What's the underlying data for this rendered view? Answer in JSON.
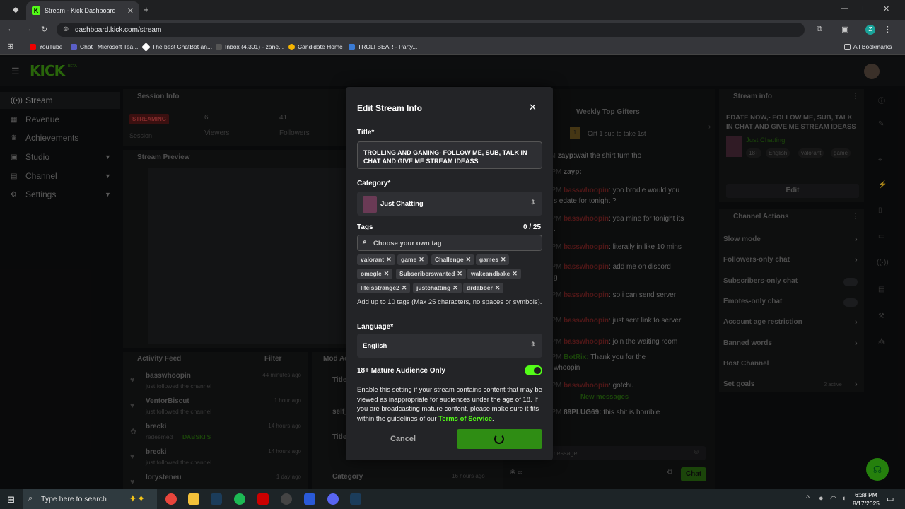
{
  "browser": {
    "tab_title": "Stream - Kick Dashboard",
    "url": "dashboard.kick.com/stream",
    "bookmarks": [
      "YouTube",
      "Chat | Microsoft Tea...",
      "The best ChatBot an...",
      "Inbox (4,301) - zane...",
      "Candidate Home",
      "TROLI BEAR - Party..."
    ],
    "all_bookmarks": "All Bookmarks"
  },
  "app": {
    "logo": "KICK",
    "logo_badge": "BETA",
    "sidebar": [
      {
        "label": "Stream",
        "active": true
      },
      {
        "label": "Revenue"
      },
      {
        "label": "Achievements"
      },
      {
        "label": "Studio",
        "chevron": true
      },
      {
        "label": "Channel",
        "chevron": true
      },
      {
        "label": "Settings",
        "chevron": true
      }
    ],
    "session": {
      "header": "Session Info",
      "status": "STREAMING",
      "status_label": "Session",
      "viewers": "6",
      "viewers_label": "Viewers",
      "followers": "41",
      "followers_label": "Followers"
    },
    "preview_header": "Stream Preview",
    "activity": {
      "header": "Activity Feed",
      "filter": "Filter",
      "items": [
        {
          "user": "basswhoopin",
          "text": "just followed the channel",
          "time": "44 minutes ago"
        },
        {
          "user": "VentorBiscut",
          "text": "just followed the channel",
          "time": "1 hour ago"
        },
        {
          "user": "brecki",
          "text": "redeemed",
          "extra": "DABSKI'S",
          "time": "14 hours ago"
        },
        {
          "user": "brecki",
          "text": "just followed the channel",
          "time": "14 hours ago"
        },
        {
          "user": "lorysteneu",
          "text": "",
          "time": "1 day ago"
        }
      ]
    },
    "mod": {
      "header": "Mod Ac",
      "items": [
        "Title",
        "self_",
        "Title",
        "Category"
      ],
      "time": "16 hours ago"
    },
    "chat": {
      "gifters": "Weekly Top Gifters",
      "gift_cta": "Gift 1 sub to take 1st",
      "lines": [
        {
          "time": "PM",
          "user": "zayp:",
          "text": "wait the shirt turn tho"
        },
        {
          "time": "2 PM",
          "user": "zayp:",
          "text": ""
        },
        {
          "time": "1 PM",
          "user": "basswhoopin",
          "text": ": yoo brodie would you",
          "cont": "s edate for tonight ?"
        },
        {
          "time": "1 PM",
          "user": "basswhoopin",
          "text": ": yea mine for tonight its",
          "cont": "."
        },
        {
          "time": "2 PM",
          "user": "basswhoopin",
          "text": ": literally in like 10 mins"
        },
        {
          "time": "2 PM",
          "user": "basswhoopin",
          "text": ": add me on discord",
          "cont": "g"
        },
        {
          "time": "2 PM",
          "user": "basswhoopin",
          "text": ": so i can send server"
        },
        {
          "time": "3 PM",
          "user": "basswhoopin",
          "text": ": just sent link to server"
        },
        {
          "time": "3 PM",
          "user": "basswhoopin",
          "text": ": join the waiting room"
        },
        {
          "time": "3 PM",
          "user": "BotRix:",
          "text": " Thank you for the",
          "cont": "whoopin"
        },
        {
          "time": "5 PM",
          "user": "basswhoopin",
          "text": ": gotchu"
        }
      ],
      "new_messages": "New messages",
      "last_line": {
        "time": "2 PM",
        "user": "89PLUG69:",
        "text": " this shit is horrible"
      },
      "input_placeholder": "message",
      "chat_button": "Chat"
    },
    "stream_info": {
      "header": "Stream info",
      "title": "EDATE NOW,- FOLLOW ME, SUB, TALK IN CHAT AND GIVE ME STREAM IDEASS",
      "category": "Just Chatting",
      "tags": [
        "18+",
        "English",
        "valorant",
        "game"
      ],
      "edit": "Edit"
    },
    "channel_actions": {
      "header": "Channel Actions",
      "items": [
        {
          "label": "Slow mode",
          "type": "chevron"
        },
        {
          "label": "Followers-only chat",
          "type": "chevron"
        },
        {
          "label": "Subscribers-only chat",
          "type": "toggle"
        },
        {
          "label": "Emotes-only chat",
          "type": "toggle"
        },
        {
          "label": "Account age restriction",
          "type": "chevron"
        },
        {
          "label": "Banned words",
          "type": "chevron"
        },
        {
          "label": "Host Channel",
          "type": "none"
        },
        {
          "label": "Set goals",
          "type": "chevron",
          "badge": "2 active"
        }
      ]
    }
  },
  "modal": {
    "title": "Edit Stream Info",
    "title_label": "Title*",
    "title_value": "TROLLING AND GAMING- FOLLOW ME, SUB, TALK IN CHAT AND GIVE ME STREAM IDEASS",
    "category_label": "Category*",
    "category_value": "Just Chatting",
    "tags_label": "Tags",
    "tags_count": "0 / 25",
    "tags_placeholder": "Choose your own tag",
    "tags": [
      "valorant",
      "game",
      "Challenge",
      "games",
      "omegle",
      "Subscriberswanted",
      "wakeandbake",
      "lifeisstrange2",
      "justchatting",
      "drdabber"
    ],
    "tags_help": "Add up to 10 tags (Max 25 characters, no spaces or symbols).",
    "language_label": "Language*",
    "language_value": "English",
    "mature_label": "18+ Mature Audience Only",
    "mature_on": true,
    "mature_help": "Enable this setting if your stream contains content that may be viewed as inappropriate for audiences under the age of 18. If you are broadcasting mature content, please make sure it fits within the guidelines of our",
    "tos_link": "Terms of Service",
    "period": ".",
    "cancel": "Cancel"
  },
  "taskbar": {
    "search_placeholder": "Type here to search",
    "time": "6:38 PM",
    "date": "8/17/2025"
  },
  "colors": {
    "accent": "#53fc18",
    "accent_dim": "#3f9b12",
    "modal_bg": "#232427"
  }
}
